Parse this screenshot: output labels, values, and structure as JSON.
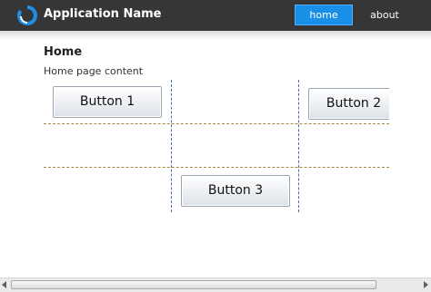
{
  "header": {
    "app_name": "Application Name",
    "nav": [
      {
        "label": "home",
        "active": true
      },
      {
        "label": "about",
        "active": false
      }
    ],
    "accent": "#1a8fe8",
    "background": "#363636"
  },
  "page": {
    "heading": "Home",
    "content": "Home page content"
  },
  "grid": {
    "buttons": [
      "Button 1",
      "Button 2",
      "Button 3"
    ]
  },
  "scrollbar": {
    "orientation": "horizontal"
  }
}
